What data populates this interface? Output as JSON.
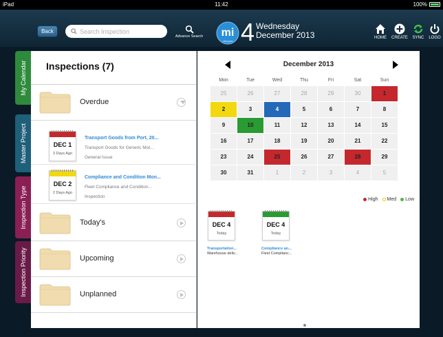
{
  "status_bar": {
    "device": "iPad",
    "time": "11:42",
    "battery": "100%"
  },
  "header": {
    "back_label": "Back",
    "search_placeholder": "Search Inspection",
    "advance_search_label": "Advance Search",
    "logo_text": "mi",
    "logo_sub": "miinspect",
    "date_number": "4",
    "date_day": "Wednesday",
    "date_month": "December 2013",
    "buttons": {
      "home": "HOME",
      "create": "CREATE",
      "sync": "SYNC",
      "logout": "LOGO"
    }
  },
  "side_tabs": [
    "My Calendar",
    "Master Project",
    "Inspection Type",
    "Inspection Priority"
  ],
  "inspections": {
    "title": "Inspections (7)",
    "overdue_label": "Overdue",
    "overdue_items": [
      {
        "date": "DEC 1",
        "ago": "3 Days Ago",
        "title": "Transport Goods from Port, 20...",
        "subtitle": "Transport Goods for Generic  Mot...",
        "category": "General Issue",
        "priority_color": "#c4282d"
      },
      {
        "date": "DEC 2",
        "ago": "2 Days Ago",
        "title": "Compliance and Condition Mon...",
        "subtitle": "Fleet Compliance and Condition...",
        "category": "Inspection",
        "priority_color": "#f2d80e"
      }
    ],
    "todays_label": "Today's",
    "upcoming_label": "Upcoming",
    "unplanned_label": "Unplanned"
  },
  "calendar": {
    "month_title": "December 2013",
    "weekdays": [
      "Mon",
      "Tue",
      "Wed",
      "Thu",
      "Fri",
      "Sat",
      "Sun"
    ],
    "weeks": [
      [
        {
          "d": "25",
          "s": "dim"
        },
        {
          "d": "26",
          "s": "dim"
        },
        {
          "d": "27",
          "s": "dim"
        },
        {
          "d": "28",
          "s": "dim"
        },
        {
          "d": "29",
          "s": "dim"
        },
        {
          "d": "30",
          "s": "dim"
        },
        {
          "d": "1",
          "s": "high"
        }
      ],
      [
        {
          "d": "2",
          "s": "med"
        },
        {
          "d": "3",
          "s": ""
        },
        {
          "d": "4",
          "s": "today"
        },
        {
          "d": "5",
          "s": ""
        },
        {
          "d": "6",
          "s": ""
        },
        {
          "d": "7",
          "s": ""
        },
        {
          "d": "8",
          "s": ""
        }
      ],
      [
        {
          "d": "9",
          "s": ""
        },
        {
          "d": "10",
          "s": "low"
        },
        {
          "d": "11",
          "s": ""
        },
        {
          "d": "12",
          "s": ""
        },
        {
          "d": "13",
          "s": ""
        },
        {
          "d": "14",
          "s": ""
        },
        {
          "d": "15",
          "s": ""
        }
      ],
      [
        {
          "d": "16",
          "s": ""
        },
        {
          "d": "17",
          "s": ""
        },
        {
          "d": "18",
          "s": ""
        },
        {
          "d": "19",
          "s": ""
        },
        {
          "d": "20",
          "s": ""
        },
        {
          "d": "21",
          "s": ""
        },
        {
          "d": "22",
          "s": ""
        }
      ],
      [
        {
          "d": "23",
          "s": ""
        },
        {
          "d": "24",
          "s": ""
        },
        {
          "d": "25",
          "s": "high"
        },
        {
          "d": "26",
          "s": ""
        },
        {
          "d": "27",
          "s": ""
        },
        {
          "d": "28",
          "s": "high"
        },
        {
          "d": "29",
          "s": ""
        }
      ],
      [
        {
          "d": "30",
          "s": ""
        },
        {
          "d": "31",
          "s": ""
        },
        {
          "d": "1",
          "s": "dim"
        },
        {
          "d": "2",
          "s": "dim"
        },
        {
          "d": "3",
          "s": "dim"
        },
        {
          "d": "4",
          "s": "dim"
        },
        {
          "d": "5",
          "s": "dim"
        }
      ]
    ],
    "legend": {
      "high": "High",
      "med": "Med",
      "low": "Low"
    },
    "colors": {
      "high": "#c4282d",
      "med": "#f2d80e",
      "low": "#2a9a33",
      "today": "#2469b7"
    }
  },
  "today_cards": [
    {
      "date": "DEC 4",
      "ago": "Today",
      "title": "Transportation...",
      "subtitle": "Warehouse deliv...",
      "color": "#c4282d"
    },
    {
      "date": "DEC 4",
      "ago": "Today",
      "title": "Compliance an...",
      "subtitle": "Fleet Complianc...",
      "color": "#2a9a33"
    }
  ]
}
